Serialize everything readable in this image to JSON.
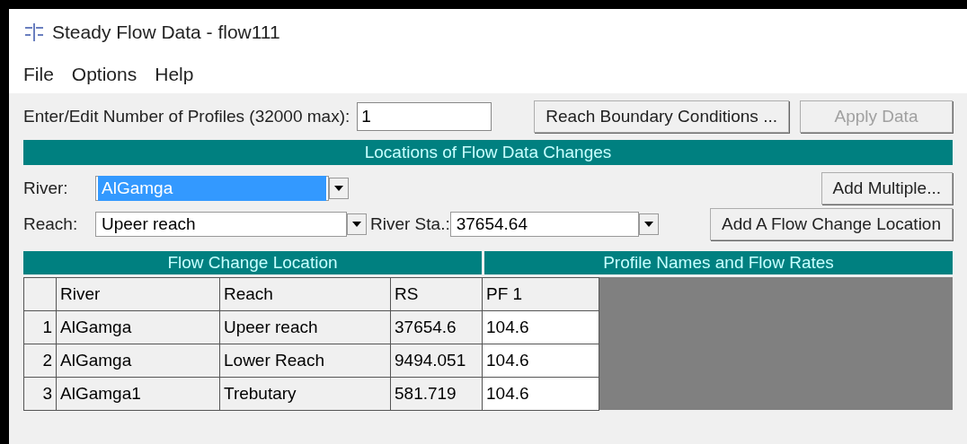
{
  "window": {
    "title": "Steady Flow Data - flow111"
  },
  "menu": [
    "File",
    "Options",
    "Help"
  ],
  "profiles": {
    "label": "Enter/Edit Number of Profiles (32000 max):",
    "value": "1"
  },
  "top_buttons": [
    {
      "label": "Reach Boundary Conditions ...",
      "disabled": false
    },
    {
      "label": "Apply Data",
      "disabled": true
    }
  ],
  "locations": {
    "title": "Locations of Flow Data Changes",
    "river": {
      "label": "River:",
      "value": "AlGamga",
      "selected": true
    },
    "add_multiple": "Add Multiple...",
    "reach": {
      "label": "Reach:",
      "value": "Upeer reach",
      "selected": false
    },
    "river_sta": {
      "label": "River Sta.:",
      "value": "37654.64",
      "selected": false
    },
    "add_location": "Add A Flow Change Location"
  },
  "table": {
    "left_title": "Flow Change Location",
    "right_title": "Profile Names and Flow Rates",
    "columns": [
      "River",
      "Reach",
      "RS",
      "PF 1"
    ],
    "rows": [
      {
        "number": "1",
        "river": "AlGamga",
        "reach": "Upeer reach",
        "rs": "37654.6",
        "flow": "104.6"
      },
      {
        "number": "2",
        "river": "AlGamga",
        "reach": "Lower Reach",
        "rs": "9494.051",
        "flow": "104.6"
      },
      {
        "number": "3",
        "river": "AlGamga1",
        "reach": "Trebutary",
        "rs": "581.719",
        "flow": "104.6"
      }
    ]
  }
}
